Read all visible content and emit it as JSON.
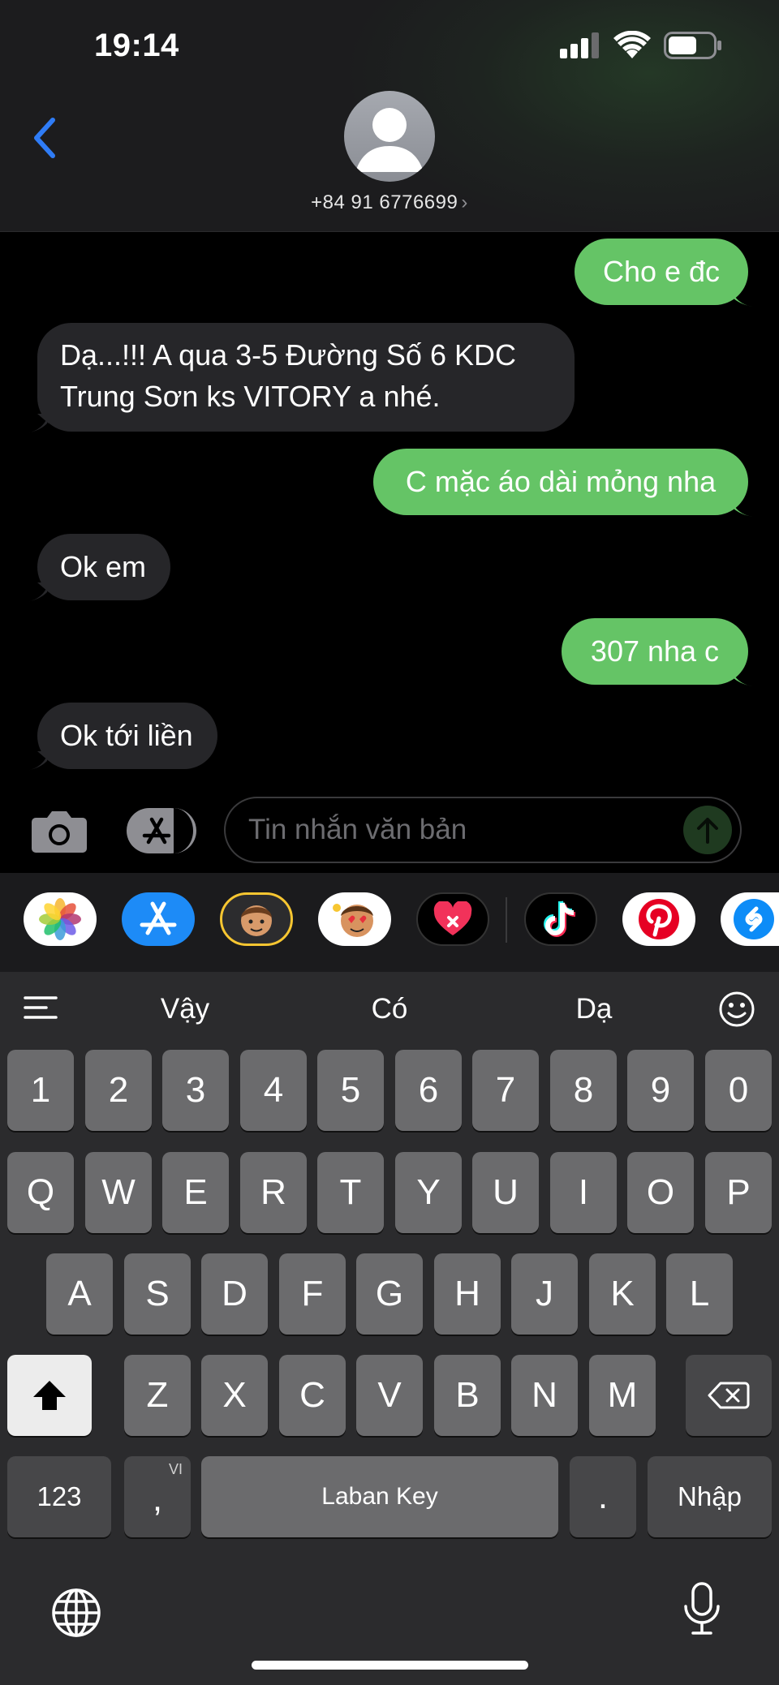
{
  "status_bar": {
    "time": "19:14"
  },
  "header": {
    "contact_number": "+84 91 6776699",
    "chevron": "›"
  },
  "messages": [
    {
      "direction": "out",
      "text": "Cho e đc"
    },
    {
      "direction": "in",
      "text": "Dạ...!!! A qua 3-5 Đường Số 6  KDC Trung Sơn ks VITORY a nhé."
    },
    {
      "direction": "out",
      "text": "C mặc áo dài mỏng nha"
    },
    {
      "direction": "in",
      "text": "Ok em"
    },
    {
      "direction": "out",
      "text": "307 nha c"
    },
    {
      "direction": "in",
      "text": "Ok tới liền"
    }
  ],
  "input_bar": {
    "placeholder": "Tin nhắn văn bản"
  },
  "app_drawer": {
    "apps": [
      "photos-app-icon",
      "app-store-icon",
      "memoji-sticker-icon",
      "animoji-icon",
      "digital-touch-icon",
      "tiktok-icon",
      "pinterest-icon",
      "shazam-icon"
    ]
  },
  "keyboard": {
    "suggestions": [
      "Vậy",
      "Có",
      "Dạ"
    ],
    "number_row": [
      "1",
      "2",
      "3",
      "4",
      "5",
      "6",
      "7",
      "8",
      "9",
      "0"
    ],
    "row1": [
      "Q",
      "W",
      "E",
      "R",
      "T",
      "Y",
      "U",
      "I",
      "O",
      "P"
    ],
    "row2": [
      "A",
      "S",
      "D",
      "F",
      "G",
      "H",
      "J",
      "K",
      "L"
    ],
    "row3": [
      "Z",
      "X",
      "C",
      "V",
      "B",
      "N",
      "M"
    ],
    "numbers_key": "123",
    "comma_key": ",",
    "comma_superscript": "VI",
    "space_key": "Laban Key",
    "period_key": ".",
    "return_key": "Nhập"
  },
  "colors": {
    "outgoing_bubble": "#65c466",
    "incoming_bubble": "#262629",
    "back_chevron": "#2f7cf6"
  }
}
